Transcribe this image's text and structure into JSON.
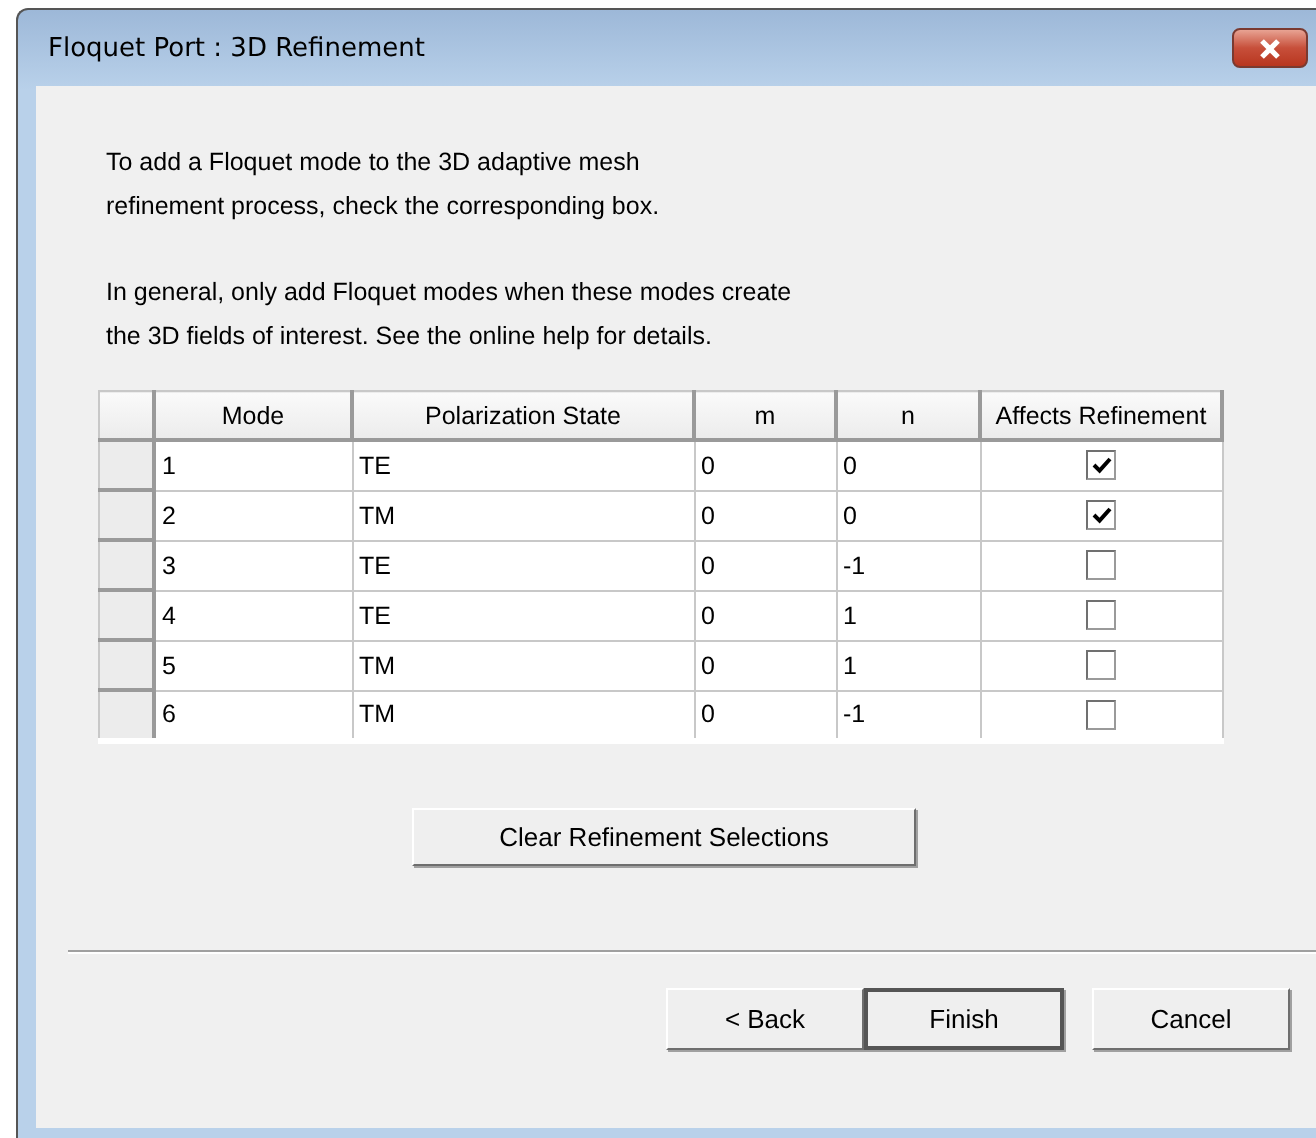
{
  "window": {
    "title": "Floquet Port : 3D Refinement"
  },
  "paragraphs": [
    "To add a Floquet mode to the 3D adaptive mesh\nrefinement process, check the corresponding box.",
    "In general, only add Floquet modes when these modes create\nthe 3D fields of interest.  See the online help for details."
  ],
  "table": {
    "columns": [
      "Mode",
      "Polarization State",
      "m",
      "n",
      "Affects Refinement"
    ],
    "rows": [
      {
        "mode": "1",
        "polarization": "TE",
        "m": "0",
        "n": "0",
        "checked": true
      },
      {
        "mode": "2",
        "polarization": "TM",
        "m": "0",
        "n": "0",
        "checked": true
      },
      {
        "mode": "3",
        "polarization": "TE",
        "m": "0",
        "n": "-1",
        "checked": false
      },
      {
        "mode": "4",
        "polarization": "TE",
        "m": "0",
        "n": "1",
        "checked": false
      },
      {
        "mode": "5",
        "polarization": "TM",
        "m": "0",
        "n": "1",
        "checked": false
      },
      {
        "mode": "6",
        "polarization": "TM",
        "m": "0",
        "n": "-1",
        "checked": false
      }
    ]
  },
  "clear_button": "Clear Refinement Selections",
  "buttons": [
    {
      "label": "< Back",
      "default": false
    },
    {
      "label": "Finish",
      "default": true
    },
    {
      "label": "Cancel",
      "default": false
    }
  ]
}
